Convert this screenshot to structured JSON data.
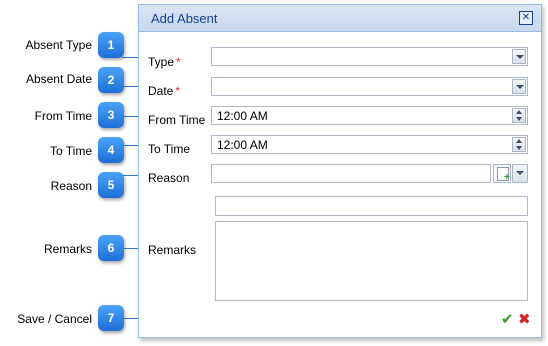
{
  "dialog": {
    "title": "Add Absent",
    "close_icon": "close-icon",
    "fields": {
      "type_label": "Type",
      "date_label": "Date",
      "from_time_label": "From Time",
      "from_time_value": "12:00 AM",
      "to_time_label": "To Time",
      "to_time_value": "12:00 AM",
      "reason_label": "Reason",
      "remarks_label": "Remarks",
      "required_mark": "*"
    },
    "footer": {
      "save_icon": "check-icon",
      "cancel_icon": "cross-icon"
    }
  },
  "callouts": [
    {
      "number": "1",
      "label": "Absent Type"
    },
    {
      "number": "2",
      "label": "Absent Date"
    },
    {
      "number": "3",
      "label": "From Time"
    },
    {
      "number": "4",
      "label": "To Time"
    },
    {
      "number": "5",
      "label": "Reason"
    },
    {
      "number": "6",
      "label": "Remarks"
    },
    {
      "number": "7",
      "label": "Save / Cancel"
    }
  ],
  "colors": {
    "accent": "#1e6fd6",
    "title_text": "#15428b",
    "required": "#e0262a",
    "save": "#3c9a2a",
    "cancel": "#d32222"
  }
}
